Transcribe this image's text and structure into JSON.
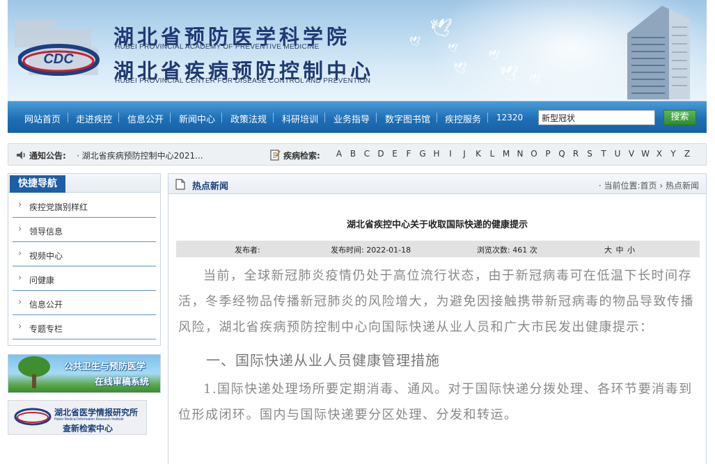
{
  "header": {
    "title_cn_1": "湖北省预防医学科学院",
    "title_en_1": "HUBEI PROVINCIAL ACADEMY OF PREVENTIVE MEDICINE",
    "title_cn_2": "湖北省疾病预防控制中心",
    "title_en_2": "HUBEI PROVINCIAL CENTER FOR DISEASE CONTROL AND PREVENTION",
    "logo_text": "CDC"
  },
  "nav": {
    "items": [
      "网站首页",
      "走进疾控",
      "信息公开",
      "新闻中心",
      "政策法规",
      "科研培训",
      "业务指导",
      "数字图书馆",
      "疾控服务",
      "12320"
    ],
    "search_value": "新型冠状",
    "search_button": "搜索"
  },
  "notice": {
    "label": "通知公告:",
    "text": "· 湖北省疾病预防控制中心2021...",
    "disease_label": "疾病检索:",
    "letters": [
      "A",
      "B",
      "C",
      "D",
      "E",
      "F",
      "G",
      "H",
      "I",
      "J",
      "K",
      "L",
      "M",
      "N",
      "O",
      "P",
      "Q",
      "R",
      "S",
      "T",
      "U",
      "V",
      "W",
      "X",
      "Y",
      "Z"
    ]
  },
  "sidebar": {
    "title": "快捷导航",
    "items": [
      "疾控党旗别样红",
      "领导信息",
      "视频中心",
      "问健康",
      "信息公开",
      "专题专栏"
    ],
    "banner1_line1": "公共卫生与预防医学",
    "banner1_line2": "在线审稿系统",
    "banner2_line1": "湖北省医学情报研究所",
    "banner2_line2": "Hubei Medical Information Research Institute",
    "banner2_line3": "查新检索中心"
  },
  "main": {
    "panel_title": "热点新闻",
    "breadcrumb_prefix": "· 当前位置:",
    "breadcrumb_home": "首页",
    "breadcrumb_sep": " › ",
    "breadcrumb_current": "热点新闻",
    "article_title": "湖北省疾控中心关于收取国际快递的健康提示",
    "meta": {
      "publisher": "发布者:",
      "publish_time": "发布时间: 2022-01-18",
      "views": "浏览次数: 461 次",
      "font_size": "大 中 小"
    },
    "paragraph1": "当前，全球新冠肺炎疫情仍处于高位流行状态，由于新冠病毒可在低温下长时间存活，冬季经物品传播新冠肺炎的风险增大，为避免因接触携带新冠病毒的物品导致传播风险，湖北省疾病预防控制中心向国际快递从业人员和广大市民发出健康提示：",
    "heading1": "一、国际快递从业人员健康管理措施",
    "paragraph2": "1.国际快递处理场所要定期消毒、通风。对于国际快递分拨处理、各环节要消毒到位形成闭环。国内与国际快递要分区处理、分发和转运。"
  }
}
